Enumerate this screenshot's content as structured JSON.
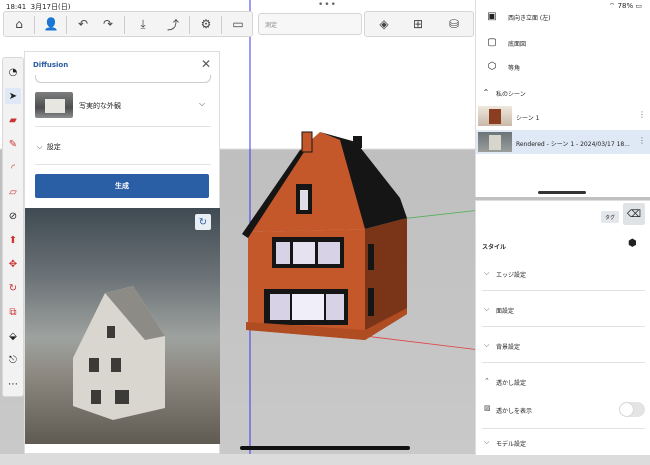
{
  "status": {
    "time": "18:41",
    "date": "3月17日(日)",
    "battery": "78%"
  },
  "toolbar": {
    "search_placeholder": "測定"
  },
  "diffusion": {
    "title": "Diffusion",
    "style_label": "写実的な外観",
    "settings_label": "設定",
    "generate_label": "生成"
  },
  "views": [
    {
      "label": "西向き立面 (左)",
      "icon": "elevation-west-icon"
    },
    {
      "label": "底面図",
      "icon": "bottom-view-icon"
    },
    {
      "label": "等角",
      "icon": "isometric-icon"
    }
  ],
  "scenes": {
    "header": "私のシーン",
    "items": [
      {
        "label": "シーン 1"
      },
      {
        "label": "Rendered - シーン 1 - 2024/03/17 18..."
      }
    ]
  },
  "styles": {
    "tag_label": "タグ",
    "title": "スタイル",
    "sections": [
      {
        "label": "エッジ設定",
        "expanded": false
      },
      {
        "label": "面設定",
        "expanded": false
      },
      {
        "label": "背景設定",
        "expanded": false
      },
      {
        "label": "透かし設定",
        "expanded": true
      },
      {
        "label": "モデル設定",
        "expanded": false
      }
    ],
    "watermark_toggle_label": "透かしを表示"
  },
  "colors": {
    "accent": "#2a5ea5",
    "selection": "#dfe8f5"
  }
}
